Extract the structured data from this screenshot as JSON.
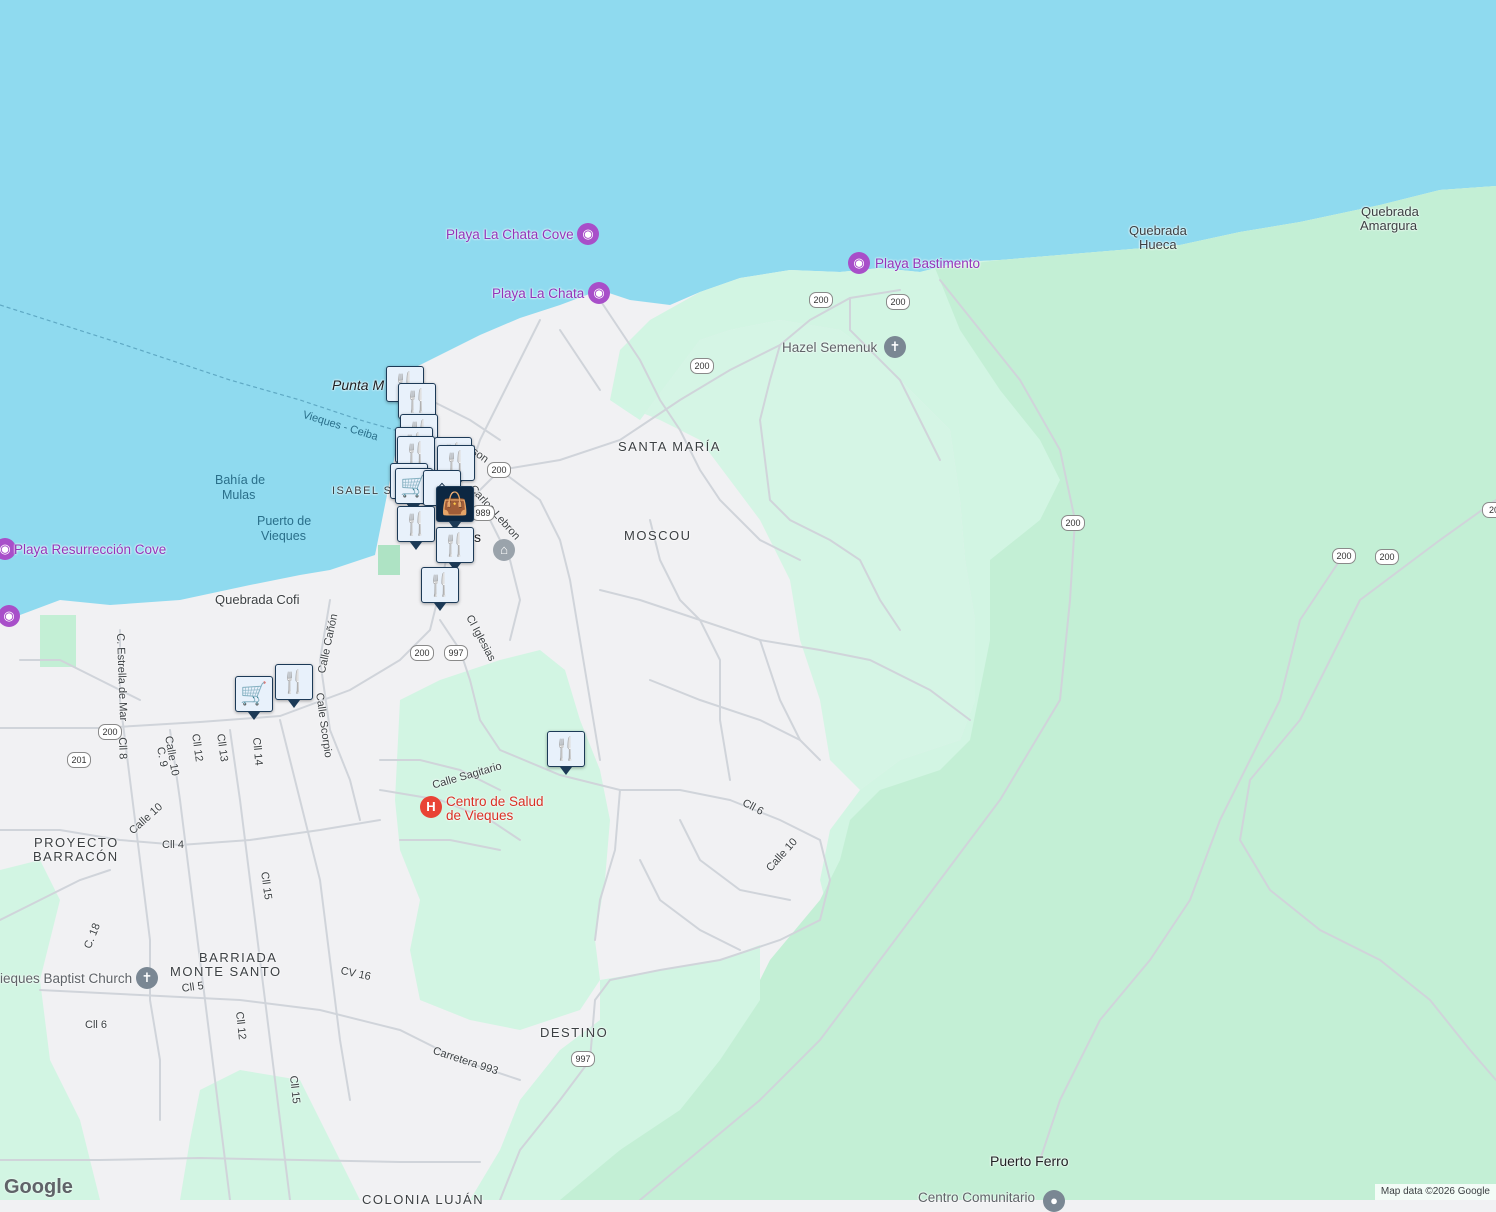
{
  "map": {
    "colors": {
      "water": "#8fdaef",
      "land": "#f1f1f3",
      "green": "#d2f5e3",
      "park": "#c3efd5",
      "road": "#ffffff",
      "road_edge": "#d0d4da",
      "marker_bg": "#e8f1fb",
      "marker_border": "#1c3a57"
    },
    "areas": [
      "SANTA MARÍA",
      "MOSCOU",
      "ISABEL SE",
      "PROYECTO",
      "BARRACÓN",
      "BARRIADA",
      "MONTE SANTO",
      "DESTINO",
      "COLONIA LUJÁN"
    ],
    "water_labels": [
      "Bahía de",
      "Mulas",
      "Puerto de",
      "Vieques"
    ],
    "beaches": [
      "Playa La Chata Cove",
      "Playa La Chata",
      "Playa Bastimento",
      "Playa Resurrección Cove"
    ],
    "places": {
      "punta": "Punta M",
      "puerto_ferro": "Puerto Ferro",
      "centro_comunitario": "Centro Comunitario",
      "hazel": "Hazel Semenuk",
      "baptist": "ieques Baptist Church",
      "clinic_line1": "Centro de Salud",
      "clinic_line2": "de Vieques",
      "town_fragment": "s"
    },
    "natural": {
      "qh1": "Quebrada",
      "qh2": "Hueca",
      "qa1": "Quebrada",
      "qa2": "Amargura",
      "cofi": "Quebrada Cofi"
    },
    "ferry": "Vieques - Ceiba",
    "streets": [
      "rdson",
      "Carlos Lebron",
      "Cl Iglesias",
      "Calle Cañón",
      "Calle Scorpio",
      "Calle Sagitario",
      "C. Estrella de Mar",
      "Cll 8",
      "Calle 10",
      "C. 9",
      "Cll 12",
      "Cll 13",
      "Cll 14",
      "Calle 10",
      "Cll 4",
      "Cll 15",
      "C. 18",
      "CV 16",
      "Cll 5",
      "Cll 6",
      "Cll 12",
      "Cll 15",
      "Carretera 993",
      "Cll 6",
      "Calle 10"
    ],
    "route_shields": [
      "200",
      "200",
      "200",
      "200",
      "200",
      "200",
      "200",
      "200",
      "989",
      "997",
      "200",
      "201",
      "997",
      "20"
    ],
    "markers": [
      "restaurant",
      "restaurant",
      "restaurant",
      "restaurant",
      "restaurant",
      "restaurant",
      "shopping-cart",
      "home",
      "shopping-bag",
      "restaurant",
      "restaurant",
      "restaurant",
      "shopping-cart",
      "restaurant",
      "restaurant"
    ],
    "google_logo": "Google",
    "attribution": "Map data ©2026 Google"
  }
}
